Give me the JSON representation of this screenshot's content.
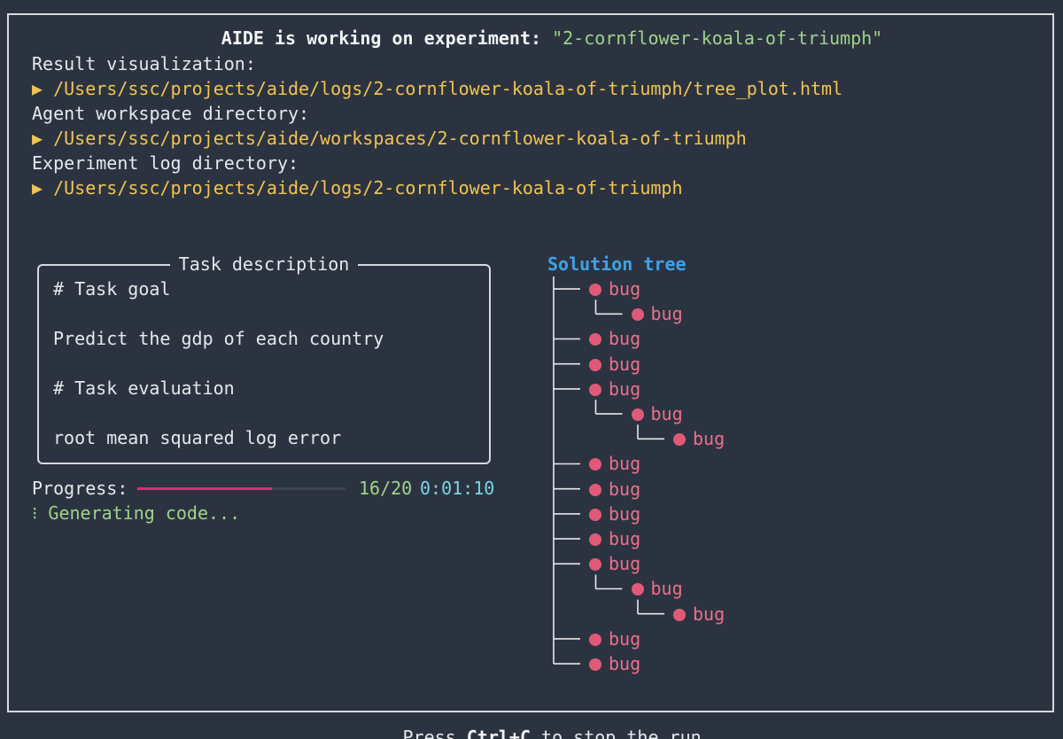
{
  "header": {
    "prefix": "AIDE is working on experiment:",
    "experiment": "\"2-cornflower-koala-of-triumph\""
  },
  "info": {
    "visualization_label": "Result visualization:",
    "visualization_path": "▶ /Users/ssc/projects/aide/logs/2-cornflower-koala-of-triumph/tree_plot.html",
    "workspace_label": "Agent workspace directory:",
    "workspace_path": "▶ /Users/ssc/projects/aide/workspaces/2-cornflower-koala-of-triumph",
    "log_label": "Experiment log directory:",
    "log_path": "▶ /Users/ssc/projects/aide/logs/2-cornflower-koala-of-triumph"
  },
  "task": {
    "title": "Task description",
    "lines": [
      "# Task goal",
      "Predict the gdp of each country",
      "# Task evaluation",
      "root mean squared log error"
    ]
  },
  "progress": {
    "label": "Progress:",
    "fraction": 0.8,
    "count": "16/20",
    "elapsed": "0:01:10",
    "status": "⁝ Generating code..."
  },
  "tree": {
    "title": "Solution tree",
    "node_label": "bug",
    "node_color": "#e05a78",
    "nodes": [
      {
        "depth": 0,
        "label": "bug"
      },
      {
        "depth": 1,
        "label": "bug"
      },
      {
        "depth": 0,
        "label": "bug"
      },
      {
        "depth": 0,
        "label": "bug"
      },
      {
        "depth": 0,
        "label": "bug"
      },
      {
        "depth": 1,
        "label": "bug"
      },
      {
        "depth": 2,
        "label": "bug"
      },
      {
        "depth": 0,
        "label": "bug"
      },
      {
        "depth": 0,
        "label": "bug"
      },
      {
        "depth": 0,
        "label": "bug"
      },
      {
        "depth": 0,
        "label": "bug"
      },
      {
        "depth": 0,
        "label": "bug"
      },
      {
        "depth": 1,
        "label": "bug"
      },
      {
        "depth": 2,
        "label": "bug"
      },
      {
        "depth": 0,
        "label": "bug"
      },
      {
        "depth": 0,
        "label": "bug"
      }
    ]
  },
  "footer": {
    "before": "Press ",
    "key": "Ctrl+C",
    "after": " to stop the run"
  },
  "colors": {
    "background": "#2c3340",
    "path": "#f0c453",
    "green": "#9fd38c",
    "cyan": "#7ad3e3",
    "progress_fill": "#e0287a",
    "tree_title": "#3ea2e8",
    "bug": "#ec6f8d"
  }
}
